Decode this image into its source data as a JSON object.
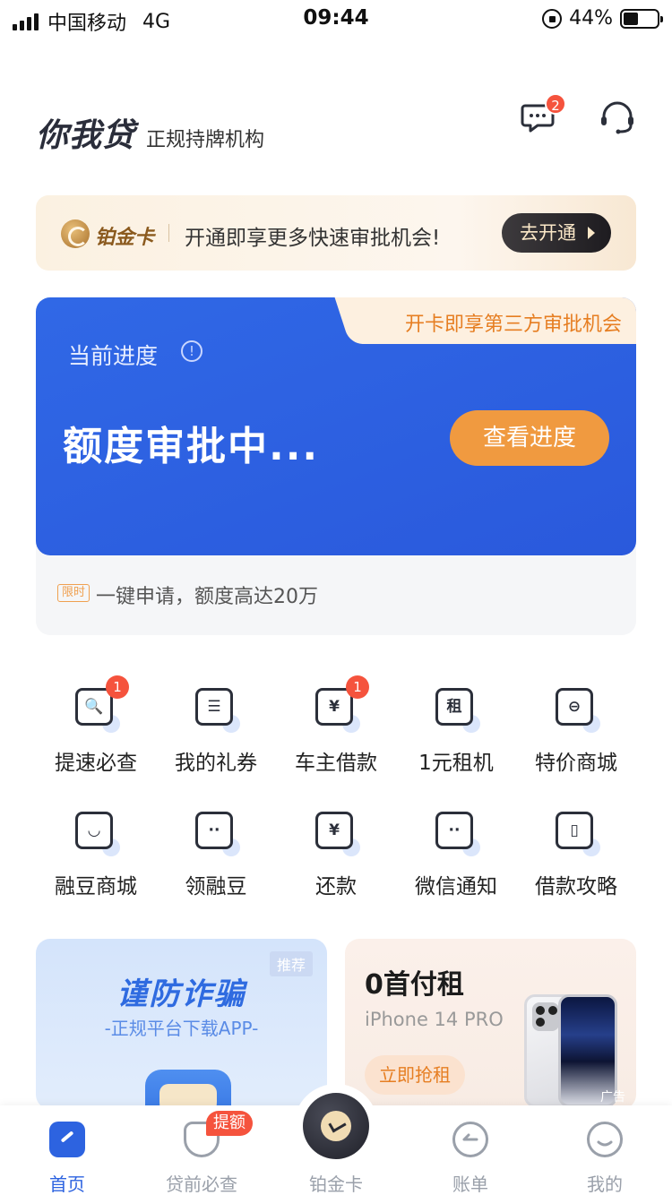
{
  "status_bar": {
    "carrier": "中国移动",
    "network": "4G",
    "time": "09:44",
    "battery": "44%",
    "battery_level": 0.44
  },
  "header": {
    "logo": "你我贷",
    "subtitle": "正规持牌机构",
    "message_badge": "2"
  },
  "platinum_banner": {
    "name": "铂金卡",
    "text": "开通即享更多快速审批机会!",
    "button": "去开通"
  },
  "progress_card": {
    "promo": "开卡即享第三方审批机会",
    "label": "当前进度",
    "info_glyph": "!",
    "status": "额度审批中...",
    "button": "查看进度",
    "limit_tag": "限时",
    "limit_text": "一键申请，额度高达20万"
  },
  "quick_grid": [
    {
      "label": "提速必查",
      "icon": "shield-search-icon",
      "glyph": "🔍",
      "badge": "1"
    },
    {
      "label": "我的礼券",
      "icon": "coupon-icon",
      "glyph": "☰",
      "badge": ""
    },
    {
      "label": "车主借款",
      "icon": "car-yen-icon",
      "glyph": "¥",
      "badge": "1"
    },
    {
      "label": "1元租机",
      "icon": "phone-rent-icon",
      "glyph": "租",
      "badge": ""
    },
    {
      "label": "特价商城",
      "icon": "cart-icon",
      "glyph": "⊖",
      "badge": ""
    },
    {
      "label": "融豆商城",
      "icon": "bag-icon",
      "glyph": "◡",
      "badge": ""
    },
    {
      "label": "领融豆",
      "icon": "bean-icon",
      "glyph": "··",
      "badge": ""
    },
    {
      "label": "还款",
      "icon": "repay-yen-icon",
      "glyph": "¥",
      "badge": ""
    },
    {
      "label": "微信通知",
      "icon": "wechat-icon",
      "glyph": "··",
      "badge": ""
    },
    {
      "label": "借款攻略",
      "icon": "guide-bookmark-icon",
      "glyph": "▯",
      "badge": ""
    }
  ],
  "promo_left": {
    "tag": "推荐",
    "title": "谨防诈骗",
    "subtitle": "-正规平台下载APP-"
  },
  "promo_right": {
    "title": "0首付租",
    "subtitle": "iPhone 14 PRO",
    "button": "立即抢租",
    "ad": "广告"
  },
  "tab_bar": {
    "tabs": [
      {
        "label": "首页",
        "icon": "home-icon",
        "active": true
      },
      {
        "label": "贷前必查",
        "icon": "shield-check-icon",
        "badge": "提额"
      },
      {
        "label": "铂金卡",
        "icon": "platinum-card-icon"
      },
      {
        "label": "账单",
        "icon": "bill-back-icon"
      },
      {
        "label": "我的",
        "icon": "profile-icon"
      }
    ]
  },
  "colors": {
    "primary_blue": "#2d63e0",
    "orange": "#f09a40",
    "badge_red": "#f5533d",
    "gold": "#8b5a1e"
  }
}
